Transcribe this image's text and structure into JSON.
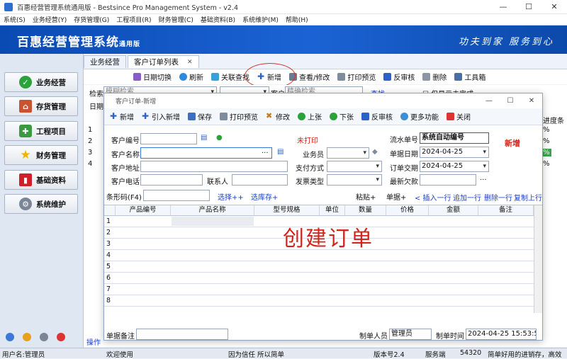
{
  "window": {
    "title": "百惠经营管理系统通用版 - Bestsince Pro Management System - v2.4",
    "min": "—",
    "max": "☐",
    "close": "✕"
  },
  "menu": [
    "系统(S)",
    "业务经营(Y)",
    "存货管理(G)",
    "工程项目(R)",
    "财务管理(C)",
    "基础资料(B)",
    "系统维护(M)",
    "帮助(H)"
  ],
  "banner": {
    "name": "百惠经营管理系统",
    "edition": "通用版",
    "slogan": "功夫到家 服务到心"
  },
  "nav": [
    "业务经营",
    "存货管理",
    "工程项目",
    "财务管理",
    "基础资料",
    "系统维护"
  ],
  "tabs": [
    "业务经营",
    "客户订单列表"
  ],
  "main_toolbar": [
    "日期切换",
    "刷新",
    "关联查找",
    "新增",
    "查看/修改",
    "打印预览",
    "反审核",
    "删除",
    "工具箱"
  ],
  "behind": {
    "search_label": "检索",
    "search_ph": "模糊检索",
    "customer_label": "客户",
    "customer_ph": "精确检索",
    "find": "查找",
    "only_unfinished": "仅显示未完成",
    "date_label": "日期",
    "rows": [
      "1",
      "2",
      "3",
      "4"
    ],
    "progress_header": "进度条",
    "progress": [
      "%",
      "%",
      "%",
      "%"
    ],
    "operation": "操作"
  },
  "dialog": {
    "title": "客户订单-新增",
    "toolbar": [
      "新增",
      "引入新增",
      "保存",
      "打印预览",
      "修改",
      "上张",
      "下张",
      "反审核",
      "更多功能",
      "关闭"
    ],
    "status_print": "未打印",
    "status_new": "新增",
    "fields": {
      "cust_code": "客户编号",
      "cust_name": "客户名称",
      "cust_addr": "客户地址",
      "cust_phone": "客户电话",
      "contact": "联系人",
      "salesman": "业务员",
      "pay_method": "支付方式",
      "invoice_type": "发票类型",
      "serial_no_label": "流水单号",
      "serial_no": "系统自动编号",
      "doc_date_label": "单据日期",
      "doc_date": "2024-04-25",
      "order_date_label": "订单交期",
      "order_date": "2024-04-25",
      "latest_owed": "最新欠款",
      "ellipsis": "..."
    },
    "barcode_label": "条形码(F4)",
    "select_plus": "选择++",
    "select_stock_plus": "选库存+",
    "paste_plus": "粘贴+",
    "doc_plus": "单据+",
    "insert_row": "< 插入一行",
    "append_row": "追加一行",
    "delete_row": "删除一行",
    "copy_row": "复制上行",
    "grid_headers": [
      "产品编号",
      "产品名称",
      "型号规格",
      "单位",
      "数量",
      "价格",
      "金额",
      "备注"
    ],
    "grid_rows": [
      "1",
      "2",
      "3",
      "4",
      "5",
      "6",
      "7",
      "8"
    ],
    "big_note": "创建订单",
    "remark_label": "单据备注",
    "maker_label": "制单人员",
    "maker": "管理员",
    "time_label": "制单时间",
    "time": "2024-04-25 15:53:58"
  },
  "status": {
    "user": "用户名:管理员",
    "welcome": "欢迎使用",
    "motto": "因为信任 所以简单",
    "version": "版本号2.4",
    "server": "服务端",
    "port": "54320",
    "tip": "简单好用的进销存，高效"
  },
  "colors": {
    "banner": "#1b63d4",
    "red": "#d0241c",
    "link": "#1b3fc7"
  }
}
